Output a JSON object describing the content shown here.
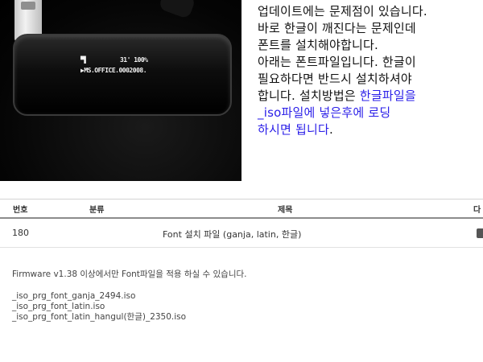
{
  "device_screen": {
    "status_icon": "folder-icon",
    "status_text": "31' 100%",
    "track_text": "▶MS.OFFICE.0002008."
  },
  "note": {
    "line1": "업데이트에는 문제점이 있습니다.",
    "line2": "바로 한글이 깨진다는 문제인데",
    "line3": "폰트를 설치해야합니다.",
    "line4": "아래는 폰트파일입니다. 한글이",
    "line5": "필요하다면 반드시 설치하셔야",
    "line6_plain": "합니다. 설치방법은 ",
    "line6_highlight": "한글파일을",
    "line7_highlight": "_iso파일에 넣은후에 로딩",
    "line8_highlight": "하시면 됩니다",
    "line8_end": ".",
    "highlight_color": "#2a1ee8"
  },
  "board": {
    "headers": {
      "number": "번호",
      "category": "분류",
      "title": "제목",
      "extra": "다"
    },
    "row": {
      "number": "180",
      "title": "Font 설치 파일 (ganja, latin, 한글)"
    }
  },
  "post": {
    "intro": "Firmware v1.38 이상에서만 Font파일을 적용 하실 수 있습니다.",
    "files": [
      "_iso_prg_font_ganja_2494.iso",
      "_iso_prg_font_latin.iso",
      "_iso_prg_font_latin_hangul(한글)_2350.iso"
    ]
  }
}
